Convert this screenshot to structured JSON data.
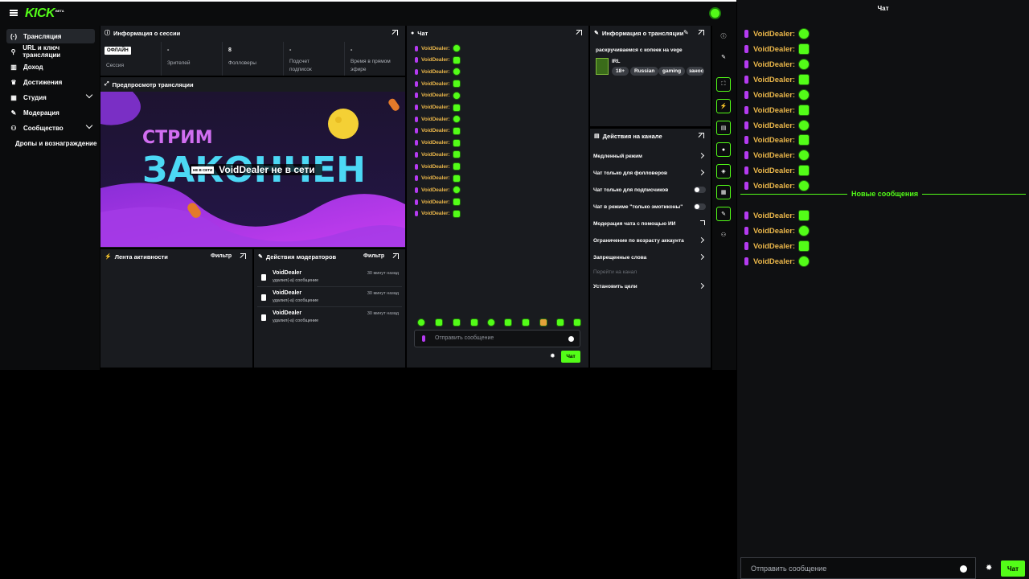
{
  "header": {
    "logo": "KICK",
    "beta": "BETA"
  },
  "sidebar": {
    "items": [
      {
        "label": "Трансляция",
        "icon": "broadcast-icon",
        "glyph": "(·)"
      },
      {
        "label": "URL и ключ трансляции",
        "icon": "link-icon",
        "glyph": "⚲"
      },
      {
        "label": "Доход",
        "icon": "chart-icon",
        "glyph": "▥"
      },
      {
        "label": "Достижения",
        "icon": "trophy-icon",
        "glyph": "♛"
      },
      {
        "label": "Студия",
        "icon": "studio-icon",
        "glyph": "▦"
      },
      {
        "label": "Модерация",
        "icon": "wrench-icon",
        "glyph": "✎"
      },
      {
        "label": "Сообщество",
        "icon": "community-icon",
        "glyph": "⚇"
      },
      {
        "label": "Дропы и вознаграждение",
        "icon": "",
        "glyph": ""
      }
    ]
  },
  "session": {
    "title": "Информация о сессии",
    "offline_badge": "ОФЛАЙН",
    "session_label": "Сессия",
    "stats": [
      {
        "value": "-",
        "label": "Зрителей"
      },
      {
        "value": "8",
        "label": "Фолловеры"
      },
      {
        "value": "-",
        "label": "Подсчет подписок"
      },
      {
        "value": "-",
        "label": "Время в прямом эфире"
      }
    ]
  },
  "preview": {
    "title": "Предпросмотр трансляции",
    "banner_line1": "СТРИМ",
    "banner_line2": "ЗАКОНЧЕН",
    "offline_badge": "НЕ В СЕТИ",
    "offline_text": "VoidDealer не в сети"
  },
  "activity": {
    "title": "Лента активности",
    "filter": "Фильтр"
  },
  "modactions": {
    "title": "Действия модераторов",
    "filter": "Фильтр",
    "entries": [
      {
        "name": "VoidDealer",
        "action": "удалил(-а) сообщение",
        "time": "30 минут назад"
      },
      {
        "name": "VoidDealer",
        "action": "удалил(-а) сообщение",
        "time": "30 минут назад"
      },
      {
        "name": "VoidDealer",
        "action": "удалил(-а) сообщение",
        "time": "30 минут назад"
      }
    ]
  },
  "chat": {
    "title": "Чат",
    "user": "VoidDealer:",
    "placeholder": "Отправить сообщение",
    "send": "Чат",
    "message_count": 15
  },
  "streaminfo": {
    "title": "Информация о трансляции",
    "stream_title": "раскручиваемся с копеек на vege",
    "category": "IRL",
    "tags": [
      "18+",
      "Russian",
      "gaming",
      "занос"
    ]
  },
  "channelactions": {
    "title": "Действия на канале",
    "rows": [
      {
        "label": "Медленный режим",
        "control": "chevron"
      },
      {
        "label": "Чат только для фолловеров",
        "control": "chevron"
      },
      {
        "label": "Чат только для подписчиков",
        "control": "toggle"
      },
      {
        "label": "Чат в режиме \"только эмотиконы\"",
        "control": "toggle"
      },
      {
        "label": "Модерация чата с помощью ИИ",
        "control": "external"
      },
      {
        "label": "Ограничение по возрасту аккаунта",
        "control": "chevron"
      },
      {
        "label": "Запрещенные слова",
        "control": "chevron"
      },
      {
        "label": "Перейти на канал",
        "control": "none"
      },
      {
        "label": "Установить цели",
        "control": "chevron"
      }
    ]
  },
  "rightchat": {
    "title": "Чат",
    "user": "VoidDealer:",
    "new_messages": "Новые сообщения",
    "placeholder": "Отправить сообщение",
    "send": "Чат"
  },
  "colors": {
    "accent": "#53fc18",
    "username": "#eab64a",
    "panel": "#191b1f",
    "mic": "#b53bf1"
  }
}
